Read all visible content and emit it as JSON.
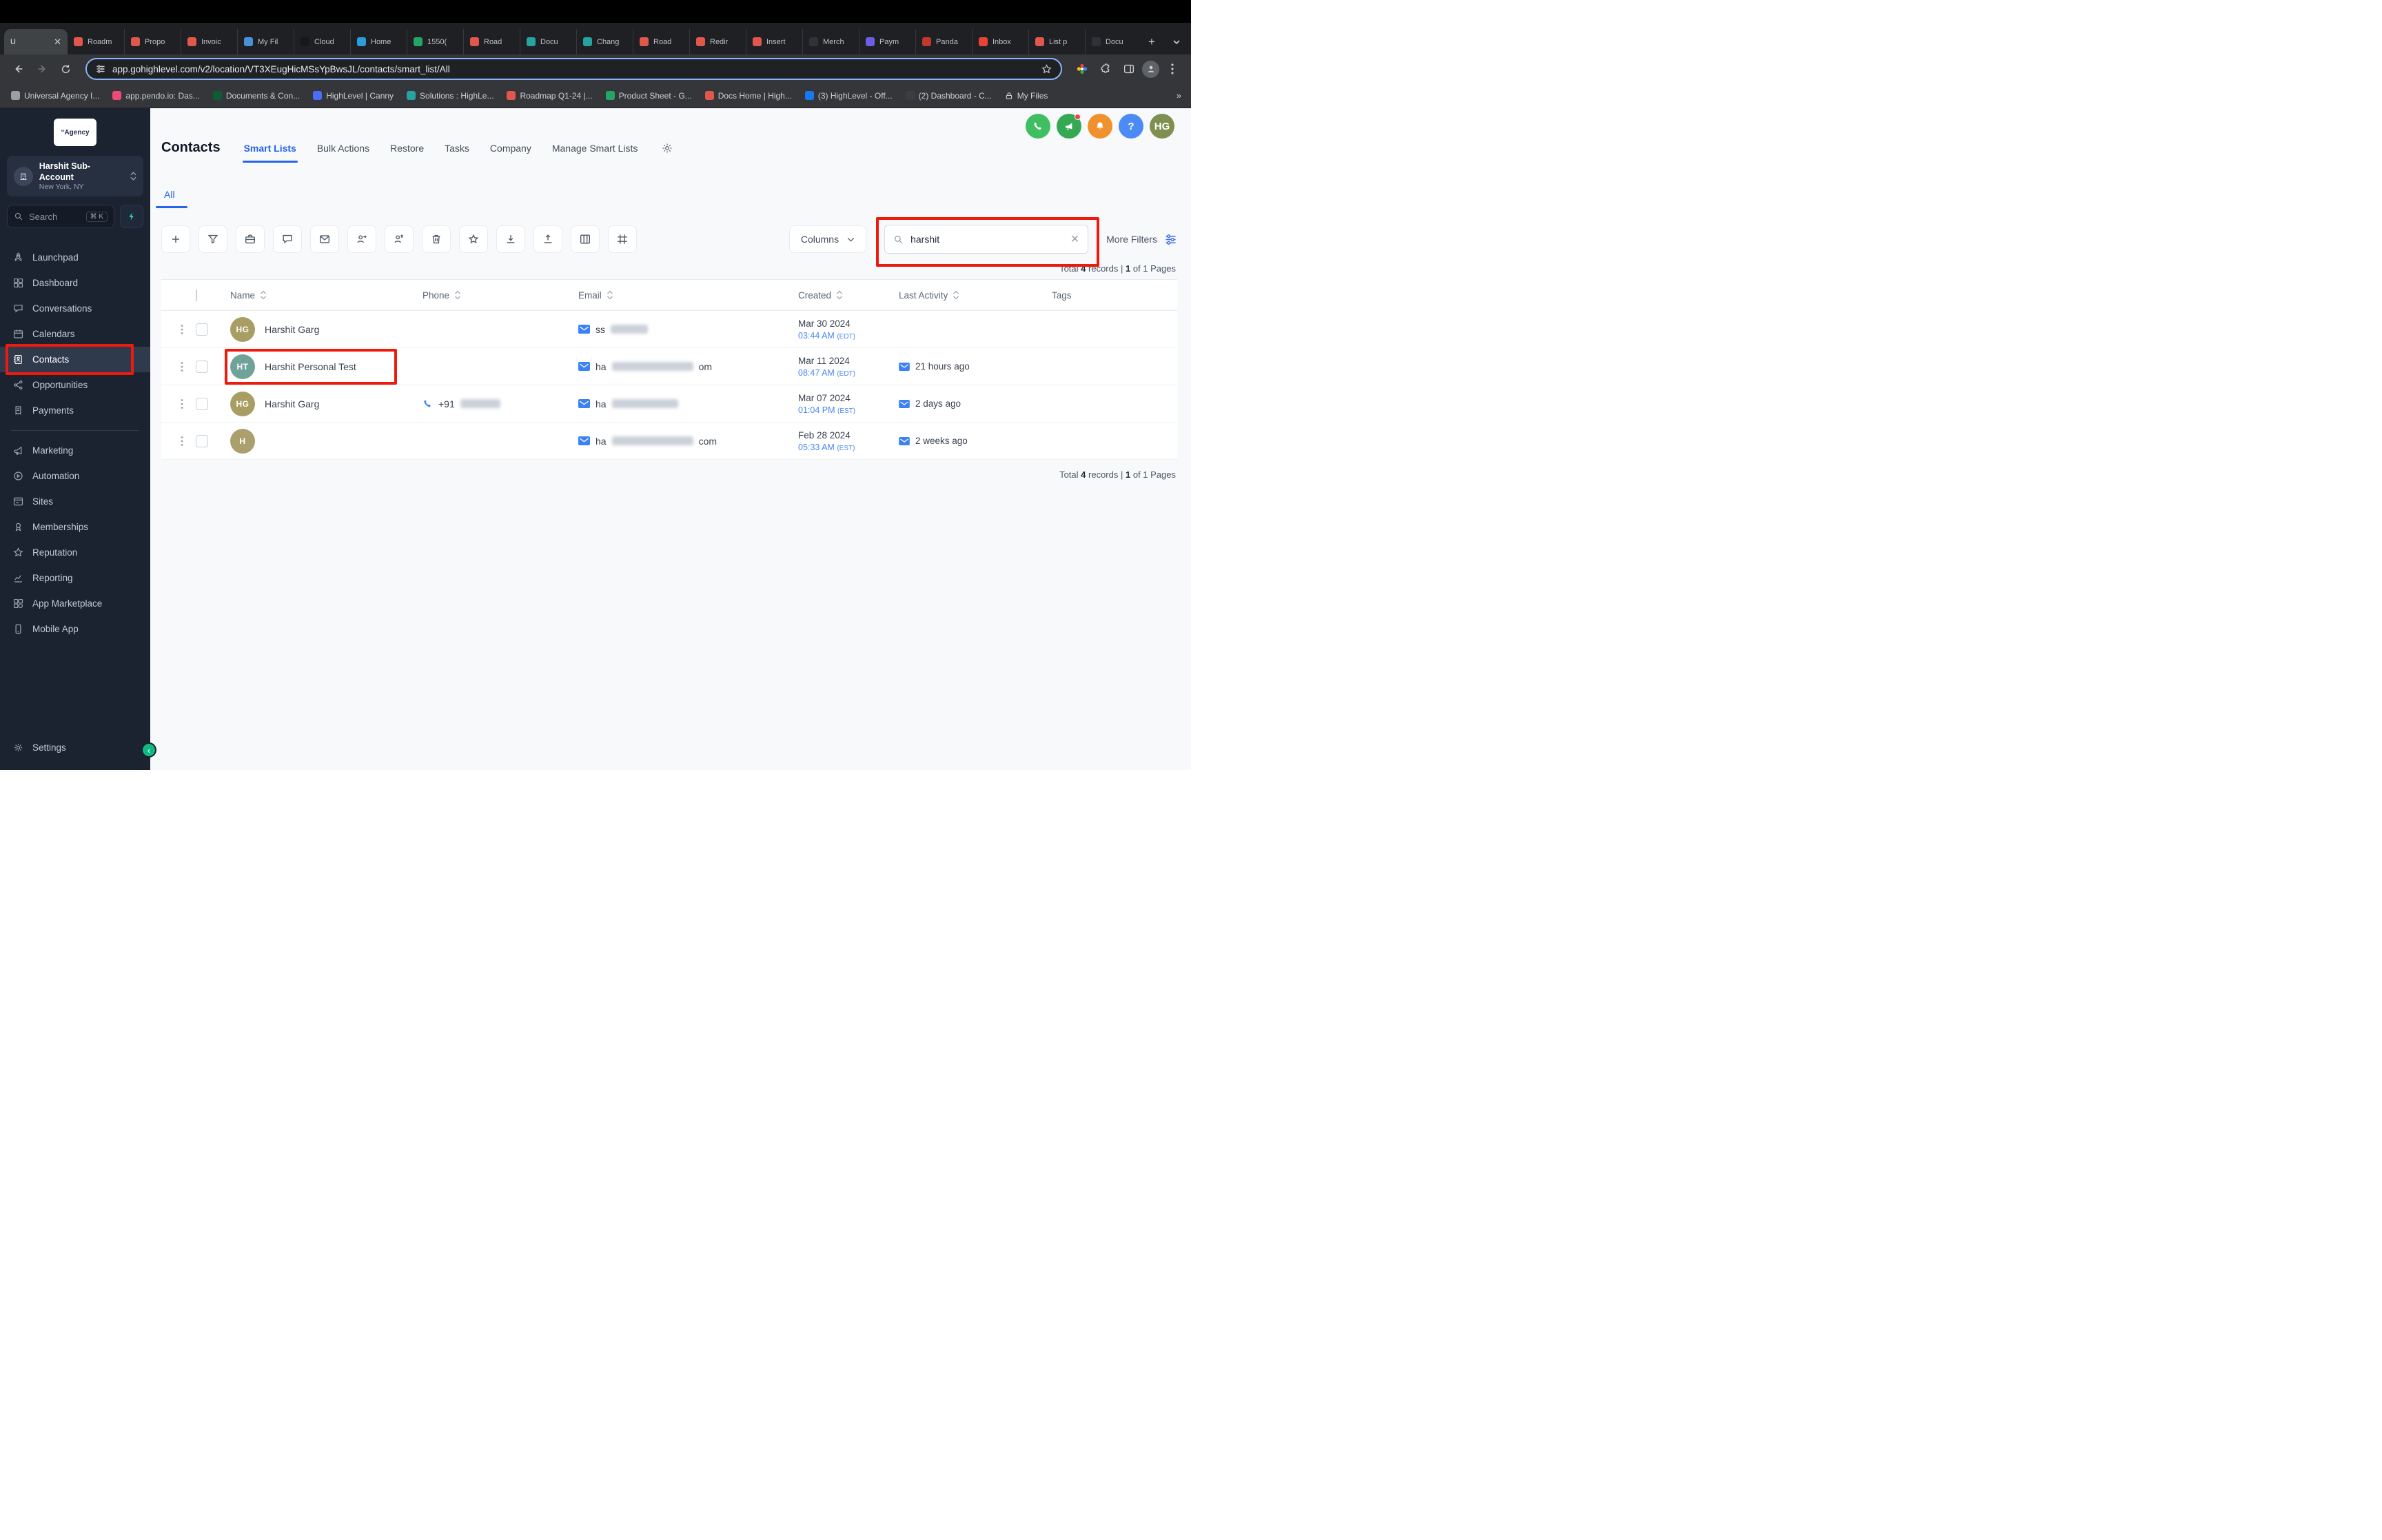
{
  "colors": {
    "accent": "#2563eb",
    "annotation_red": "#ee1a0d",
    "sidebar_bg": "#1c2330",
    "phone_green": "#3fbf62",
    "announce_green": "#35a854",
    "bell_orange": "#f0912e",
    "help_blue": "#4c8bf5",
    "avatar_olive": "#a89d62",
    "avatar_teal": "#6fa39a"
  },
  "browser": {
    "active_tab": {
      "label": "U"
    },
    "tabs": [
      {
        "label": "Roadm",
        "color": "#e2574c"
      },
      {
        "label": "Propo",
        "color": "#e2574c"
      },
      {
        "label": "Invoic",
        "color": "#e2574c"
      },
      {
        "label": "My Fil",
        "color": "#4a90d9"
      },
      {
        "label": "Cloud",
        "color": "#15181d"
      },
      {
        "label": "Home",
        "color": "#2d9cdb"
      },
      {
        "label": "1550(",
        "color": "#23a566"
      },
      {
        "label": "Road",
        "color": "#e2574c"
      },
      {
        "label": "Docu",
        "color": "#27a2a0"
      },
      {
        "label": "Chang",
        "color": "#27a2a0"
      },
      {
        "label": "Road",
        "color": "#e2574c"
      },
      {
        "label": "Redir",
        "color": "#e2574c"
      },
      {
        "label": "Insert",
        "color": "#e2574c"
      },
      {
        "label": "Merch",
        "color": "#2f3237"
      },
      {
        "label": "Paym",
        "color": "#6c5ce7"
      },
      {
        "label": "Panda",
        "color": "#c0392b"
      },
      {
        "label": "Inbox",
        "color": "#ea4335"
      },
      {
        "label": "List p",
        "color": "#e2574c"
      },
      {
        "label": "Docu",
        "color": "#2f3237"
      }
    ],
    "url": "app.gohighlevel.com/v2/location/VT3XEugHicMSsYpBwsJL/contacts/smart_list/All",
    "bookmarks": [
      {
        "label": "Universal Agency I...",
        "color": "#9aa0a6"
      },
      {
        "label": "app.pendo.io: Das...",
        "color": "#ec4b7a"
      },
      {
        "label": "Documents & Con...",
        "color": "#0c5d36"
      },
      {
        "label": "HighLevel | Canny",
        "color": "#4a6cf7"
      },
      {
        "label": "Solutions : HighLe...",
        "color": "#27a2a0"
      },
      {
        "label": "Roadmap Q1-24 |...",
        "color": "#e2574c"
      },
      {
        "label": "Product Sheet - G...",
        "color": "#23a566"
      },
      {
        "label": "Docs Home | High...",
        "color": "#e2574c"
      },
      {
        "label": "(3) HighLevel - Off...",
        "color": "#1877f2"
      },
      {
        "label": "(2) Dashboard - C...",
        "color": "#3a3d42"
      },
      {
        "label": "My Files",
        "lock": true
      }
    ]
  },
  "sidebar": {
    "logo_text": "“Agency",
    "account": {
      "name": "Harshit Sub-Account",
      "location": "New York, NY"
    },
    "search": {
      "placeholder": "Search",
      "shortcut": "⌘ K"
    },
    "items": [
      {
        "label": "Launchpad"
      },
      {
        "label": "Dashboard"
      },
      {
        "label": "Conversations"
      },
      {
        "label": "Calendars"
      },
      {
        "label": "Contacts",
        "active": true
      },
      {
        "label": "Opportunities"
      },
      {
        "label": "Payments"
      },
      {
        "label": "Marketing"
      },
      {
        "label": "Automation"
      },
      {
        "label": "Sites"
      },
      {
        "label": "Memberships"
      },
      {
        "label": "Reputation"
      },
      {
        "label": "Reporting"
      },
      {
        "label": "App Marketplace"
      },
      {
        "label": "Mobile App"
      }
    ],
    "settings_label": "Settings"
  },
  "quick": {
    "avatar_initials": "HG"
  },
  "page": {
    "title": "Contacts",
    "tabs": [
      {
        "label": "Smart Lists",
        "active": true
      },
      {
        "label": "Bulk Actions"
      },
      {
        "label": "Restore"
      },
      {
        "label": "Tasks"
      },
      {
        "label": "Company"
      },
      {
        "label": "Manage Smart Lists"
      }
    ],
    "list_tabs": [
      {
        "label": "All",
        "active": true
      }
    ]
  },
  "toolbar": {
    "columns_label": "Columns",
    "search_value": "harshit",
    "more_filters_label": "More Filters"
  },
  "records": {
    "t1": "Total",
    "count": "4",
    "t2": "records |",
    "page": "1",
    "t3": "of 1 Pages"
  },
  "table": {
    "headers": [
      {
        "label": "Name"
      },
      {
        "label": "Phone"
      },
      {
        "label": "Email"
      },
      {
        "label": "Created"
      },
      {
        "label": "Last Activity"
      },
      {
        "label": "Tags"
      }
    ],
    "rows": [
      {
        "initials": "HG",
        "avatar_color": "#a89d62",
        "name": "Harshit Garg",
        "email_prefix": "ss",
        "email_blur": 54,
        "created_date": "Mar 30 2024",
        "created_time": "03:44 AM",
        "created_tz": "(EDT)"
      },
      {
        "initials": "HT",
        "avatar_color": "#6fa39a",
        "name": "Harshit Personal Test",
        "annotate": true,
        "email_prefix": "ha",
        "email_blur": 118,
        "email_suffix": "om",
        "created_date": "Mar 11 2024",
        "created_time": "08:47 AM",
        "created_tz": "(EDT)",
        "last_activity": "21 hours ago"
      },
      {
        "initials": "HG",
        "avatar_color": "#a89d62",
        "name": "Harshit Garg",
        "phone_prefix": "+91",
        "phone_blur": 58,
        "email_prefix": "ha",
        "email_blur": 96,
        "created_date": "Mar 07 2024",
        "created_time": "01:04 PM",
        "created_tz": "(EST)",
        "last_activity": "2 days ago"
      },
      {
        "initials": "H",
        "avatar_color": "#ab9f6e",
        "email_prefix": "ha",
        "email_blur": 118,
        "email_suffix": "com",
        "created_date": "Feb 28 2024",
        "created_time": "05:33 AM",
        "created_tz": "(EST)",
        "last_activity": "2 weeks ago"
      }
    ]
  }
}
